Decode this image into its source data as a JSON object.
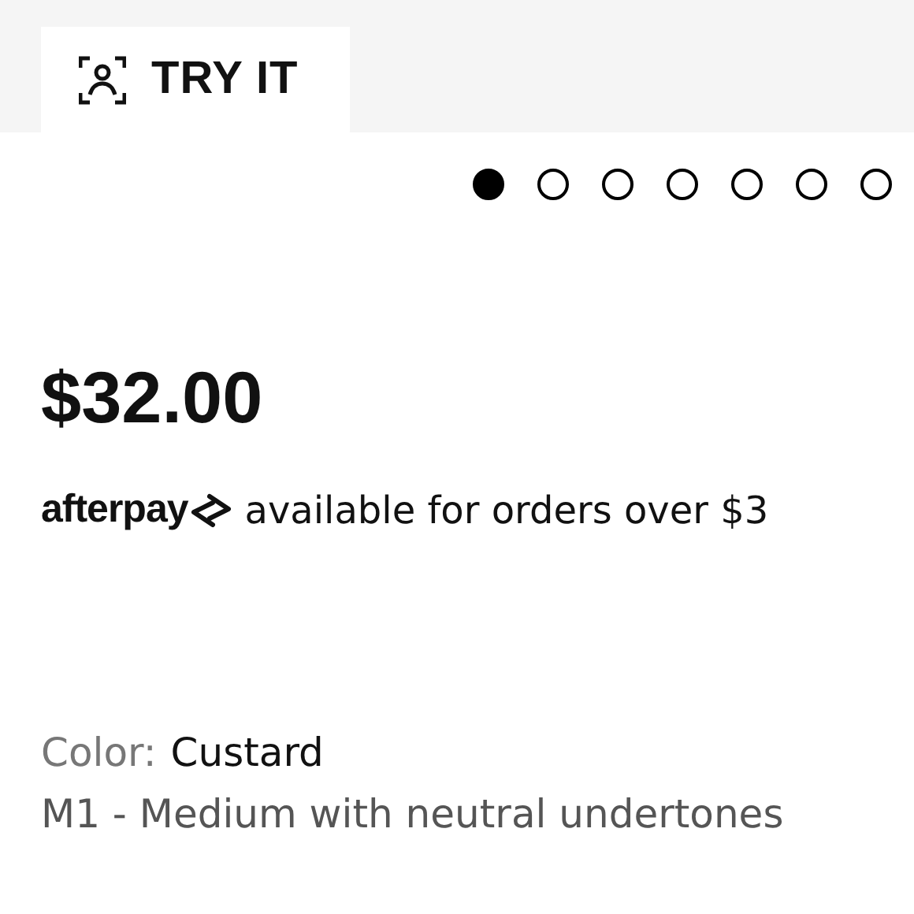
{
  "try_it_tab": {
    "label": "TRY IT"
  },
  "carousel_dots": [
    {
      "selected": true
    },
    {
      "selected": false
    },
    {
      "selected": false
    },
    {
      "selected": false
    },
    {
      "selected": false
    },
    {
      "selected": false
    },
    {
      "selected": false
    }
  ],
  "price": "$32.00",
  "afterpay": {
    "logo": "afterpay",
    "text": "available for orders over $3"
  },
  "color": {
    "label": "Color:",
    "value": "Custard"
  },
  "shade_description": "M1 - Medium with neutral undertones"
}
